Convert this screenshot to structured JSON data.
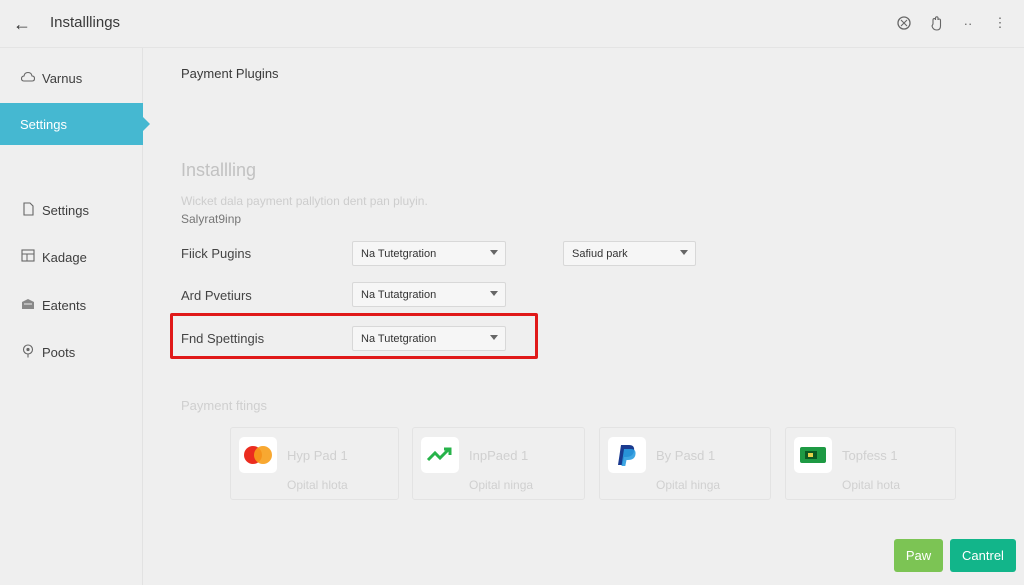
{
  "header": {
    "back_icon": "arrow-left-icon",
    "title": "Installlings",
    "icons": [
      "grid-icon",
      "hand-icon",
      "dots-icon",
      "more-vertical-icon"
    ]
  },
  "sidebar": {
    "items": [
      {
        "label": "Varnus",
        "icon": "cloud-icon",
        "active": false
      },
      {
        "label": "Settings",
        "icon": "",
        "active": true
      },
      {
        "label": "Settings",
        "icon": "file-icon",
        "active": false
      },
      {
        "label": "Kadage",
        "icon": "package-icon",
        "active": false
      },
      {
        "label": "Eatents",
        "icon": "tray-icon",
        "active": false
      },
      {
        "label": "Poots",
        "icon": "pin-icon",
        "active": false
      }
    ]
  },
  "main": {
    "breadcrumb": "Payment Plugins",
    "heading": "Installling",
    "description": "Wicket dala payment pallytion dent pan pluyin.",
    "subtext": "Salyrat9inp",
    "rows": [
      {
        "label": "Fiick Pugins",
        "select_value": "Na Tutetgration",
        "extra_select": "Safiud park"
      },
      {
        "label": "Ard Pvetiurs",
        "select_value": "Na Tutatgration"
      },
      {
        "label": "Fnd Spettingis",
        "select_value": "Na Tutetgration"
      }
    ],
    "payment_section_title": "Payment ftings",
    "cards": [
      {
        "name": "Hyp Pad 1",
        "meta": "Opital hlota",
        "icon": "mastercard-icon"
      },
      {
        "name": "InpPaed 1",
        "meta": "Opital ninga",
        "icon": "trend-chart-icon"
      },
      {
        "name": "By Pasd 1",
        "meta": "Opital hinga",
        "icon": "paypal-icon"
      },
      {
        "name": "Topfess 1",
        "meta": "Opital hota",
        "icon": "card-icon"
      }
    ]
  },
  "footer": {
    "primary_label": "Paw",
    "secondary_label": "Cantrel"
  },
  "colors": {
    "accent": "#45b8d1",
    "highlight": "#e01919",
    "primary_button": "#7cc454",
    "secondary_button": "#12b58a"
  }
}
